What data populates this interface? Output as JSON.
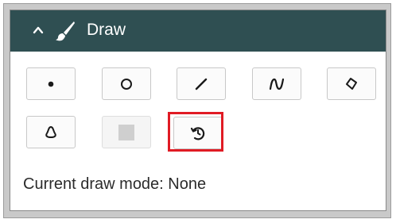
{
  "panel": {
    "title": "Draw",
    "collapse_icon": "chevron-up-icon",
    "title_icon": "paintbrush-icon",
    "header_color": "#2f4f52"
  },
  "tools": [
    {
      "name": "point",
      "icon": "point-icon",
      "enabled": true
    },
    {
      "name": "circle",
      "icon": "circle-icon",
      "enabled": true
    },
    {
      "name": "line",
      "icon": "line-icon",
      "enabled": true
    },
    {
      "name": "freehand",
      "icon": "freehand-icon",
      "enabled": true
    },
    {
      "name": "polygon",
      "icon": "polygon-icon",
      "enabled": true
    },
    {
      "name": "freehand-polygon",
      "icon": "freehand-polygon-icon",
      "enabled": true
    },
    {
      "name": "rectangle",
      "icon": "rectangle-icon",
      "enabled": false
    },
    {
      "name": "undo",
      "icon": "undo-icon",
      "enabled": true,
      "highlighted": true
    }
  ],
  "highlight_color": "#e01b24",
  "status": {
    "label": "Current draw mode: None"
  }
}
